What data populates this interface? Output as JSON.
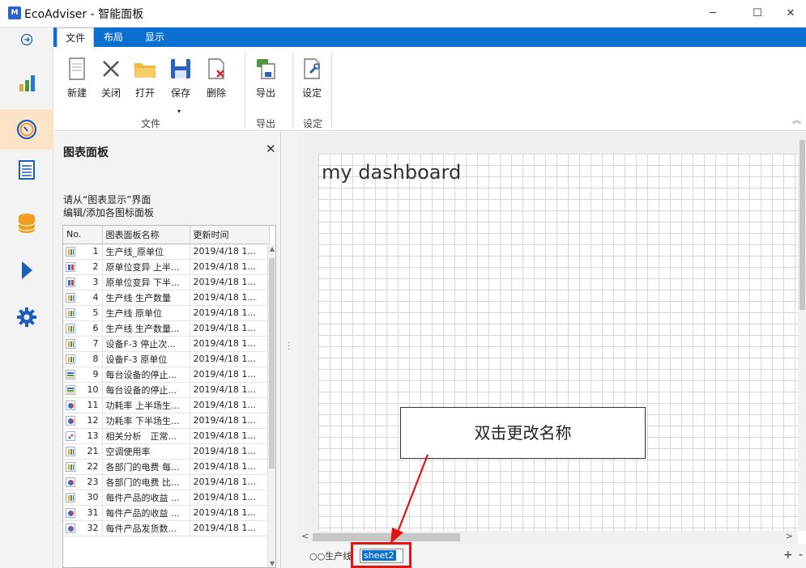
{
  "window": {
    "app_name": "EcoAdviser",
    "title": "EcoAdviser - 智能面板",
    "logo_text": "M",
    "minimize": "─",
    "maximize": "☐",
    "close": "✕"
  },
  "rail": {
    "items": [
      "expand-icon",
      "bar-chart-icon",
      "dashboard-gauge-icon",
      "report-icon",
      "database-icon",
      "play-icon",
      "settings-icon"
    ]
  },
  "ribbon": {
    "tabs": [
      "文件",
      "布局",
      "显示"
    ],
    "buttons": {
      "new": "新建",
      "close": "关闭",
      "open": "打开",
      "save": "保存",
      "delete": "删除",
      "export": "导出",
      "settings": "设定"
    },
    "groups": {
      "file": "文件",
      "export": "导出",
      "settings": "设定"
    },
    "save_dropdown": "▾",
    "collapse": "︽"
  },
  "panel": {
    "title": "图表面板",
    "close": "✕",
    "hint": "请从“图表显示”界面\n编辑/添加各图标面板",
    "columns": [
      "No.",
      "图表面板名称",
      "更新时间"
    ],
    "rows": [
      {
        "icon": "bar",
        "no": "1",
        "name": "生产线_原单位",
        "time": "2019/4/18 1..."
      },
      {
        "icon": "candle",
        "no": "2",
        "name": "原单位变异 上半...",
        "time": "2019/4/18 1..."
      },
      {
        "icon": "candle",
        "no": "3",
        "name": "原单位变异 下半...",
        "time": "2019/4/18 1..."
      },
      {
        "icon": "bar",
        "no": "4",
        "name": "生产线 生产数量",
        "time": "2019/4/18 1..."
      },
      {
        "icon": "bar",
        "no": "5",
        "name": "生产线 原单位",
        "time": "2019/4/18 1..."
      },
      {
        "icon": "bar",
        "no": "6",
        "name": "生产线 生产数量...",
        "time": "2019/4/18 1..."
      },
      {
        "icon": "bar",
        "no": "7",
        "name": "设备F-3 停止次...",
        "time": "2019/4/18 1..."
      },
      {
        "icon": "bar",
        "no": "8",
        "name": "设备F-3 原单位",
        "time": "2019/4/18 1..."
      },
      {
        "icon": "hbar",
        "no": "9",
        "name": "每台设备的停止...",
        "time": "2019/4/18 1..."
      },
      {
        "icon": "hbar",
        "no": "10",
        "name": "每台设备的停止...",
        "time": "2019/4/18 1..."
      },
      {
        "icon": "pie",
        "no": "11",
        "name": "功耗率 上半场生...",
        "time": "2019/4/18 1..."
      },
      {
        "icon": "pie",
        "no": "12",
        "name": "功耗率 下半场生...",
        "time": "2019/4/18 1..."
      },
      {
        "icon": "scatter",
        "no": "13",
        "name": "相关分析　正常...",
        "time": "2019/4/18 1..."
      },
      {
        "icon": "bar",
        "no": "21",
        "name": "空调使用率",
        "time": "2019/4/18 1..."
      },
      {
        "icon": "bar",
        "no": "22",
        "name": "各部门的电费 每...",
        "time": "2019/4/18 1..."
      },
      {
        "icon": "pie",
        "no": "23",
        "name": "各部门的电费 比...",
        "time": "2019/4/18 1..."
      },
      {
        "icon": "bar",
        "no": "30",
        "name": "每件产品的收益 ...",
        "time": "2019/4/18 1..."
      },
      {
        "icon": "pie",
        "no": "31",
        "name": "每件产品的收益 ...",
        "time": "2019/4/18 1..."
      },
      {
        "icon": "pie",
        "no": "32",
        "name": "每件产品发货数...",
        "time": "2019/4/18 1..."
      }
    ],
    "scroll_up": "▲",
    "scroll_down": "▼"
  },
  "canvas": {
    "dashboard_title": "my dashboard",
    "scroll_left": "<",
    "scroll_right": ">"
  },
  "sheets": {
    "tab1": "○○生产线",
    "editing_value": "sheet2",
    "add": "+",
    "remove": "-"
  },
  "annotation": {
    "callout_text": "双击更改名称",
    "color": "#e01515"
  }
}
